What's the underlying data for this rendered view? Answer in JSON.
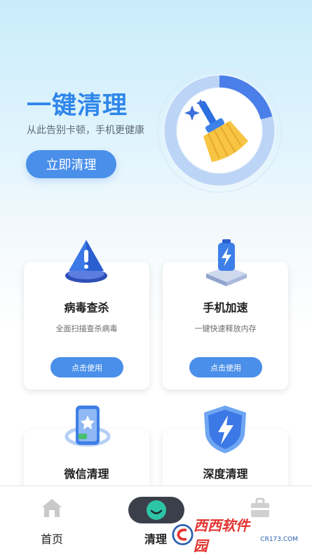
{
  "hero": {
    "title": "一键清理",
    "subtitle": "从此告别卡顿，手机更健康",
    "button_label": "立即清理"
  },
  "cards": [
    {
      "title": "病毒查杀",
      "desc": "全面扫描查杀病毒",
      "button": "点击使用",
      "icon": "warning-shield-icon"
    },
    {
      "title": "手机加速",
      "desc": "一键快速释放内存",
      "button": "点击使用",
      "icon": "battery-boost-icon"
    },
    {
      "title": "微信清理",
      "icon": "phone-chat-icon"
    },
    {
      "title": "深度清理",
      "icon": "lightning-shield-icon"
    }
  ],
  "nav": {
    "home": "首页",
    "clean": "清理",
    "toolbox_partial": "‹"
  },
  "watermark": {
    "text": "西西软件园",
    "domain": "CR173.COM"
  },
  "colors": {
    "accent": "#4a8fe9",
    "title_blue": "#2f86ea",
    "active_pill": "#3b3f4a",
    "active_face": "#2ec4a6"
  }
}
